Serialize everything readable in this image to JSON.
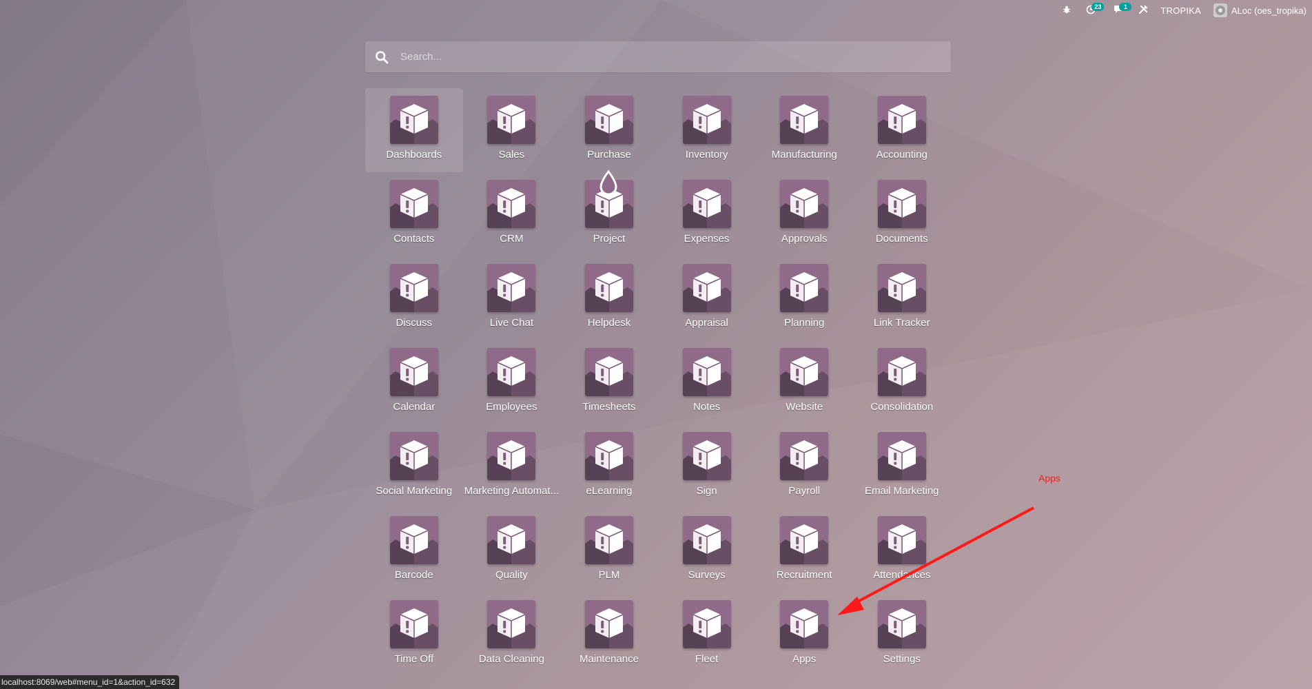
{
  "topbar": {
    "debug_icon": "bug-icon",
    "activity_icon": "clock-icon",
    "activity_count": "23",
    "messages_icon": "chat-icon",
    "messages_count": "1",
    "tools_icon": "tools-icon",
    "company": "TROPIKA",
    "user_name": "ALoc (oes_tropika)"
  },
  "search": {
    "placeholder": "Search..."
  },
  "apps": [
    "Dashboards",
    "Sales",
    "Purchase",
    "Inventory",
    "Manufacturing",
    "Accounting",
    "Contacts",
    "CRM",
    "Project",
    "Expenses",
    "Approvals",
    "Documents",
    "Discuss",
    "Live Chat",
    "Helpdesk",
    "Appraisal",
    "Planning",
    "Link Tracker",
    "Calendar",
    "Employees",
    "Timesheets",
    "Notes",
    "Website",
    "Consolidation",
    "Social Marketing",
    "Marketing Automat...",
    "eLearning",
    "Sign",
    "Payroll",
    "Email Marketing",
    "Barcode",
    "Quality",
    "PLM",
    "Surveys",
    "Recruitment",
    "Attendances",
    "Time Off",
    "Data Cleaning",
    "Maintenance",
    "Fleet",
    "Apps",
    "Settings"
  ],
  "annotation": {
    "label": "Apps",
    "color": "#ff1a1a"
  },
  "status_url": "localhost:8069/web#menu_id=1&action_id=632",
  "colors": {
    "app_icon_bg": "#8f6b89",
    "badge": "#00a09d"
  }
}
